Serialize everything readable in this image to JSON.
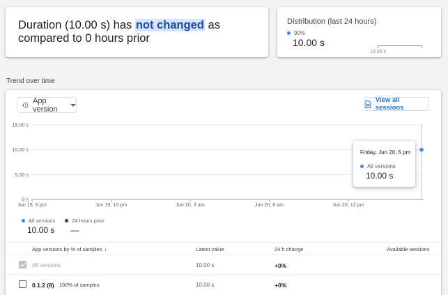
{
  "summary": {
    "prefix": "Duration (10.00 s) has ",
    "highlight": "not changed",
    "suffix": " as compared to 0 hours prior"
  },
  "distribution": {
    "title": "Distribution (last 24 hours)",
    "percentile": "90%",
    "value": "10.00 s",
    "tick": "10.00 s"
  },
  "trend": {
    "label": "Trend over time",
    "version_button": "App version",
    "sessions_button": "View all sessions"
  },
  "chart_data": {
    "type": "line",
    "y_ticks": [
      "15.00 s",
      "10.00 s",
      "5.00 s",
      "0 s"
    ],
    "ylim": [
      0,
      15
    ],
    "x_ticks": [
      "Jun 19, 6 pm",
      "Jun 19, 10 pm",
      "Jun 20, 3 am",
      "Jun 20, 8 am",
      "Jun 20, 12 pm"
    ],
    "series": [
      {
        "name": "All versions",
        "color": "#4285f4",
        "points": [
          {
            "x": "Jun 20, 5 pm",
            "y": 10
          }
        ]
      }
    ],
    "grid": true
  },
  "tooltip": {
    "date": "Friday, Jun 20, 5 pm",
    "series": "All versions",
    "value": "10.00 s"
  },
  "legend": [
    {
      "name": "All versions",
      "value": "10.00 s",
      "color": "#4285f4"
    },
    {
      "name": "24 hours prior",
      "value": "—",
      "color": "#3c4043"
    }
  ],
  "table": {
    "headers": {
      "versions": "App versions by % of samples",
      "latest": "Latest value",
      "change": "24 h change",
      "sessions": "Available sessions"
    },
    "rows": [
      {
        "name": "All versions",
        "samples": "",
        "latest": "10.00 s",
        "change": "+0%",
        "checked": true
      },
      {
        "name": "0.1.2 (8)",
        "samples": "100% of samples",
        "latest": "10.00 s",
        "change": "+0%",
        "checked": false
      }
    ]
  }
}
